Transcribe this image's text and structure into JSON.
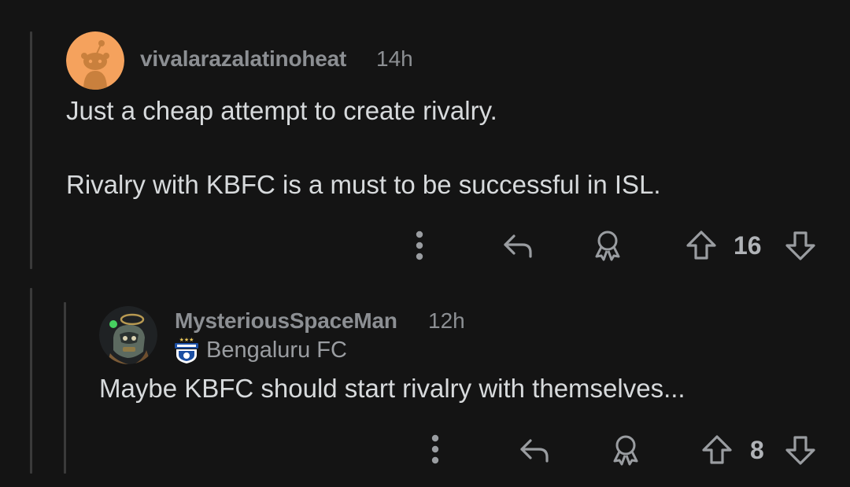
{
  "comments": [
    {
      "username": "vivalarazalatinoheat",
      "time": "14h",
      "lines": [
        "Just a cheap attempt to create rivalry.",
        "Rivalry with KBFC is a must to be successful in ISL."
      ],
      "score": "16",
      "avatar_color": "#f5a25d"
    },
    {
      "username": "MysteriousSpaceMan",
      "time": "12h",
      "flair": "Bengaluru FC",
      "lines": [
        "Maybe KBFC should start rivalry with themselves..."
      ],
      "score": "8",
      "online_color": "#46d160"
    }
  ],
  "icons": {
    "more": "more-options-icon",
    "reply": "reply-icon",
    "award": "award-icon",
    "upvote": "upvote-icon",
    "downvote": "downvote-icon"
  },
  "colors": {
    "background": "#141414",
    "thread_line": "#3a3a3a",
    "meta_text": "#8c8f93",
    "body_text": "#d7dadc",
    "icon": "#9a9da1"
  }
}
